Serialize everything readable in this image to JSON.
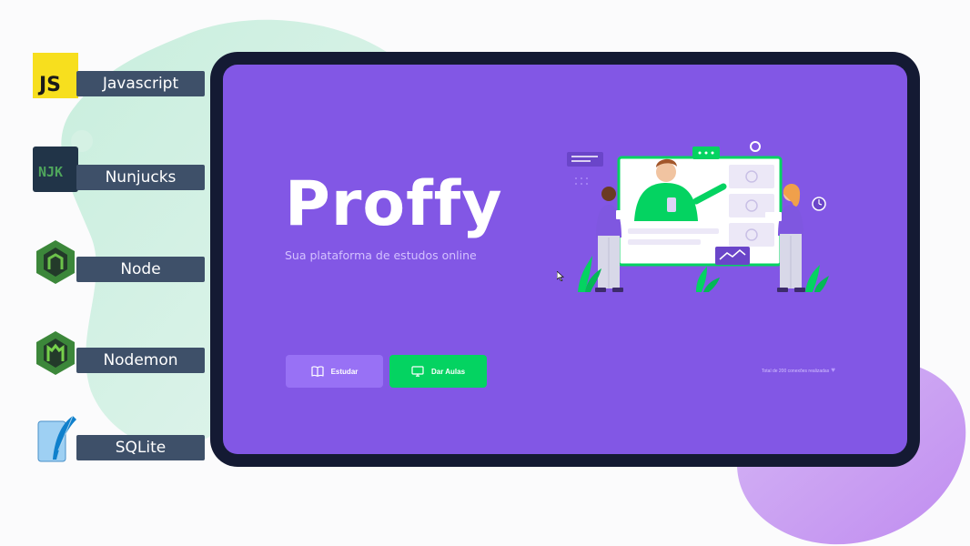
{
  "badges": [
    {
      "icon": "javascript-logo-icon",
      "label": "Javascript",
      "logo_text": "JS",
      "color": "#f7df1e"
    },
    {
      "icon": "nunjucks-logo-icon",
      "label": "Nunjucks",
      "logo_text": "NJK",
      "color": "#1c4913"
    },
    {
      "icon": "node-logo-icon",
      "label": "Node",
      "color": "#3c873a"
    },
    {
      "icon": "nodemon-logo-icon",
      "label": "Nodemon",
      "color": "#76d04b"
    },
    {
      "icon": "sqlite-logo-icon",
      "label": "SQLite",
      "color": "#0f80cc"
    }
  ],
  "app": {
    "brand": "Proffy",
    "tagline": "Sua plataforma de estudos online",
    "buttons": [
      {
        "label": "Estudar",
        "icon": "book-icon"
      },
      {
        "label": "Dar Aulas",
        "icon": "monitor-icon"
      }
    ],
    "total_connections": "Total de 200 conexões realizadas",
    "heart_icon": "purple-heart-icon"
  },
  "colors": {
    "primary": "#8257e5",
    "primary_light": "#9871f5",
    "secondary": "#04d361",
    "text_in_primary": "#d4c2ff",
    "badge_bg": "#3e5069",
    "frame": "#141a33"
  }
}
